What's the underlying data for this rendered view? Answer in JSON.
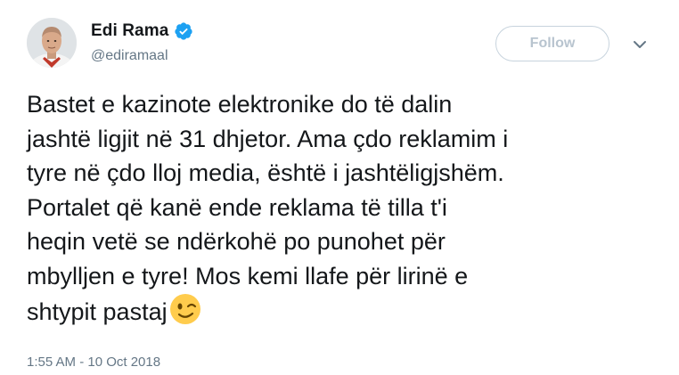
{
  "user": {
    "display_name": "Edi Rama",
    "handle": "@ediramaal",
    "verified_icon": "verified-badge-icon",
    "avatar_icon": "profile-photo"
  },
  "actions": {
    "follow_label": "Follow",
    "menu_icon": "chevron-down-icon"
  },
  "tweet": {
    "text": "Bastet e kazinote elektronike do të dalin\njashtë ligjit në 31 dhjetor. Ama çdo reklamim i\ntyre në çdo lloj media, është i jashtëligjshëm.\nPortalet që kanë ende reklama të tilla t'i\nheqin vetë se ndërkohë po punohet për\nmbylljen e tyre! Mos kemi llafe për lirinë e\nshtypit pastaj",
    "emoji": "winking-face-emoji",
    "timestamp": "1:55 AM - 10 Oct 2018"
  },
  "colors": {
    "verified_blue": "#1da1f2",
    "text_primary": "#14171a",
    "text_secondary": "#657786",
    "follow_border": "#c7d3dd",
    "follow_text": "#b8c4cf",
    "emoji_yellow": "#ffcc4d"
  }
}
